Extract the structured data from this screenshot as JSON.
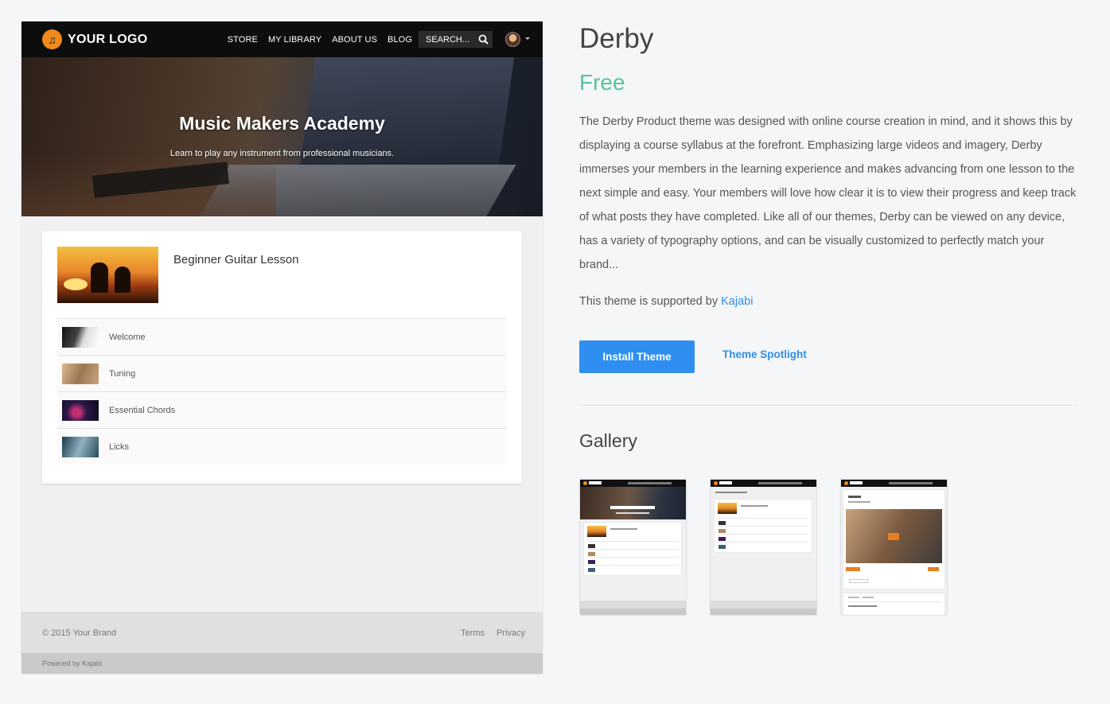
{
  "preview": {
    "navbar": {
      "logo_text": "YOUR LOGO",
      "links": [
        "STORE",
        "MY LIBRARY",
        "ABOUT US",
        "BLOG"
      ],
      "search_placeholder": "SEARCH..."
    },
    "hero": {
      "title": "Music Makers Academy",
      "subtitle": "Learn to play any instrument from professional musicians."
    },
    "course": {
      "title": "Beginner Guitar Lesson",
      "lessons": [
        "Welcome",
        "Tuning",
        "Essential Chords",
        "Licks"
      ]
    },
    "footer": {
      "copyright": "© 2015 Your Brand",
      "links": [
        "Terms",
        "Privacy"
      ],
      "powered": "Powered by Kajabi"
    }
  },
  "theme": {
    "name": "Derby",
    "price": "Free",
    "description": "The Derby Product theme was designed with online course creation in mind, and it shows this by displaying a course syllabus at the forefront. Emphasizing large videos and imagery, Derby immerses your members in the learning experience and makes advancing from one lesson to the next simple and easy. Your members will love how clear it is to view their progress and keep track of what posts they have completed. Like all of our themes, Derby can be viewed on any device, has a variety of typography options, and can be visually customized to perfectly match your brand...",
    "support_prefix": "This theme is supported by ",
    "support_link": "Kajabi",
    "install_label": "Install Theme",
    "spotlight_label": "Theme Spotlight",
    "gallery_title": "Gallery"
  },
  "colors": {
    "accent_blue": "#2f8ff0",
    "price_green": "#57c49a",
    "logo_orange": "#f08a1c"
  }
}
